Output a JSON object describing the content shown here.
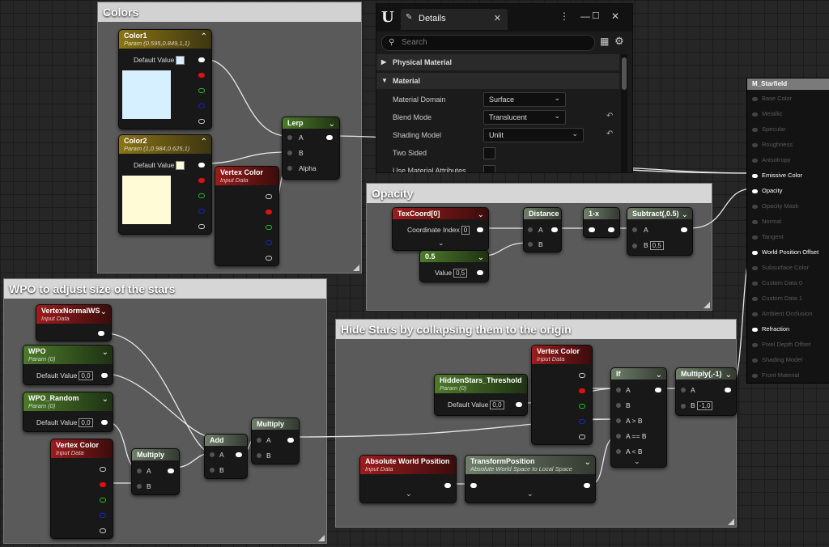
{
  "comments": {
    "colors": "Colors",
    "opacity": "Opacity",
    "wpo": "WPO to adjust size of the stars",
    "hide": "Hide Stars by collapsing them to the origin"
  },
  "nodes": {
    "color1": {
      "title": "Color1",
      "sub": "Param (0.595,0.849,1,1)",
      "default_label": "Default Value",
      "swatch": "#d6f0ff"
    },
    "color2": {
      "title": "Color2",
      "sub": "Param (1,0.984,0.625,1)",
      "default_label": "Default Value",
      "swatch": "#fffbd7"
    },
    "lerp": {
      "title": "Lerp",
      "a": "A",
      "b": "B",
      "alpha": "Alpha"
    },
    "vc1": {
      "title": "Vertex Color",
      "sub": "Input Data"
    },
    "texcoord": {
      "title": "TexCoord[0]",
      "label": "Coordinate Index",
      "value": "0"
    },
    "half": {
      "title": "0.5",
      "label": "Value",
      "value": "0,5"
    },
    "distance": {
      "title": "Distance",
      "a": "A",
      "b": "B"
    },
    "oneminus": {
      "title": "1-x"
    },
    "subtract": {
      "title": "Subtract(,0.5)",
      "a": "A",
      "b": "B",
      "bval": "0,5"
    },
    "vnormal": {
      "title": "VertexNormalWS",
      "sub": "Input Data"
    },
    "wpo": {
      "title": "WPO",
      "sub": "Param (0)",
      "label": "Default Value",
      "value": "0,0"
    },
    "wporand": {
      "title": "WPO_Random",
      "sub": "Param (0)",
      "label": "Default Value",
      "value": "0,0"
    },
    "vc2": {
      "title": "Vertex Color",
      "sub": "Input Data"
    },
    "mult1": {
      "title": "Multiply",
      "a": "A",
      "b": "B"
    },
    "add": {
      "title": "Add",
      "a": "A",
      "b": "B"
    },
    "mult2": {
      "title": "Multiply",
      "a": "A",
      "b": "B"
    },
    "vc3": {
      "title": "Vertex Color",
      "sub": "Input Data"
    },
    "threshold": {
      "title": "HiddenStars_Threshold",
      "sub": "Param (0)",
      "label": "Default Value",
      "value": "0,0"
    },
    "ifnode": {
      "title": "If",
      "a": "A",
      "b": "B",
      "agb": "A > B",
      "aeb": "A == B",
      "alb": "A < B"
    },
    "multneg": {
      "title": "Multiply(,-1)",
      "a": "A",
      "b": "B",
      "bval": "-1,0"
    },
    "awp": {
      "title": "Absolute World Position",
      "sub": "Input Data"
    },
    "transform": {
      "title": "TransformPosition",
      "sub": "Absolute World Space to Local Space"
    }
  },
  "details": {
    "tab": "Details",
    "search_placeholder": "Search",
    "sections": [
      "Physical Material",
      "Material"
    ],
    "props": [
      {
        "label": "Material Domain",
        "value": "Surface"
      },
      {
        "label": "Blend Mode",
        "value": "Translucent"
      },
      {
        "label": "Shading Model",
        "value": "Unlit"
      },
      {
        "label": "Two Sided"
      },
      {
        "label": "Use Material Attributes"
      }
    ]
  },
  "result": {
    "title": "M_Starfield",
    "pins": [
      {
        "label": "Base Color",
        "active": false
      },
      {
        "label": "Metallic",
        "active": false
      },
      {
        "label": "Specular",
        "active": false
      },
      {
        "label": "Roughness",
        "active": false
      },
      {
        "label": "Anisotropy",
        "active": false
      },
      {
        "label": "Emissive Color",
        "active": true
      },
      {
        "label": "Opacity",
        "active": true
      },
      {
        "label": "Opacity Mask",
        "active": false
      },
      {
        "label": "Normal",
        "active": false
      },
      {
        "label": "Tangent",
        "active": false
      },
      {
        "label": "World Position Offset",
        "active": true
      },
      {
        "label": "Subsurface Color",
        "active": false
      },
      {
        "label": "Custom Data 0",
        "active": false
      },
      {
        "label": "Custom Data 1",
        "active": false
      },
      {
        "label": "Ambient Occlusion",
        "active": false
      },
      {
        "label": "Refraction",
        "active": true
      },
      {
        "label": "Pixel Depth Offset",
        "active": false
      },
      {
        "label": "Shading Model",
        "active": false
      },
      {
        "label": "Front Material",
        "active": false
      }
    ]
  }
}
